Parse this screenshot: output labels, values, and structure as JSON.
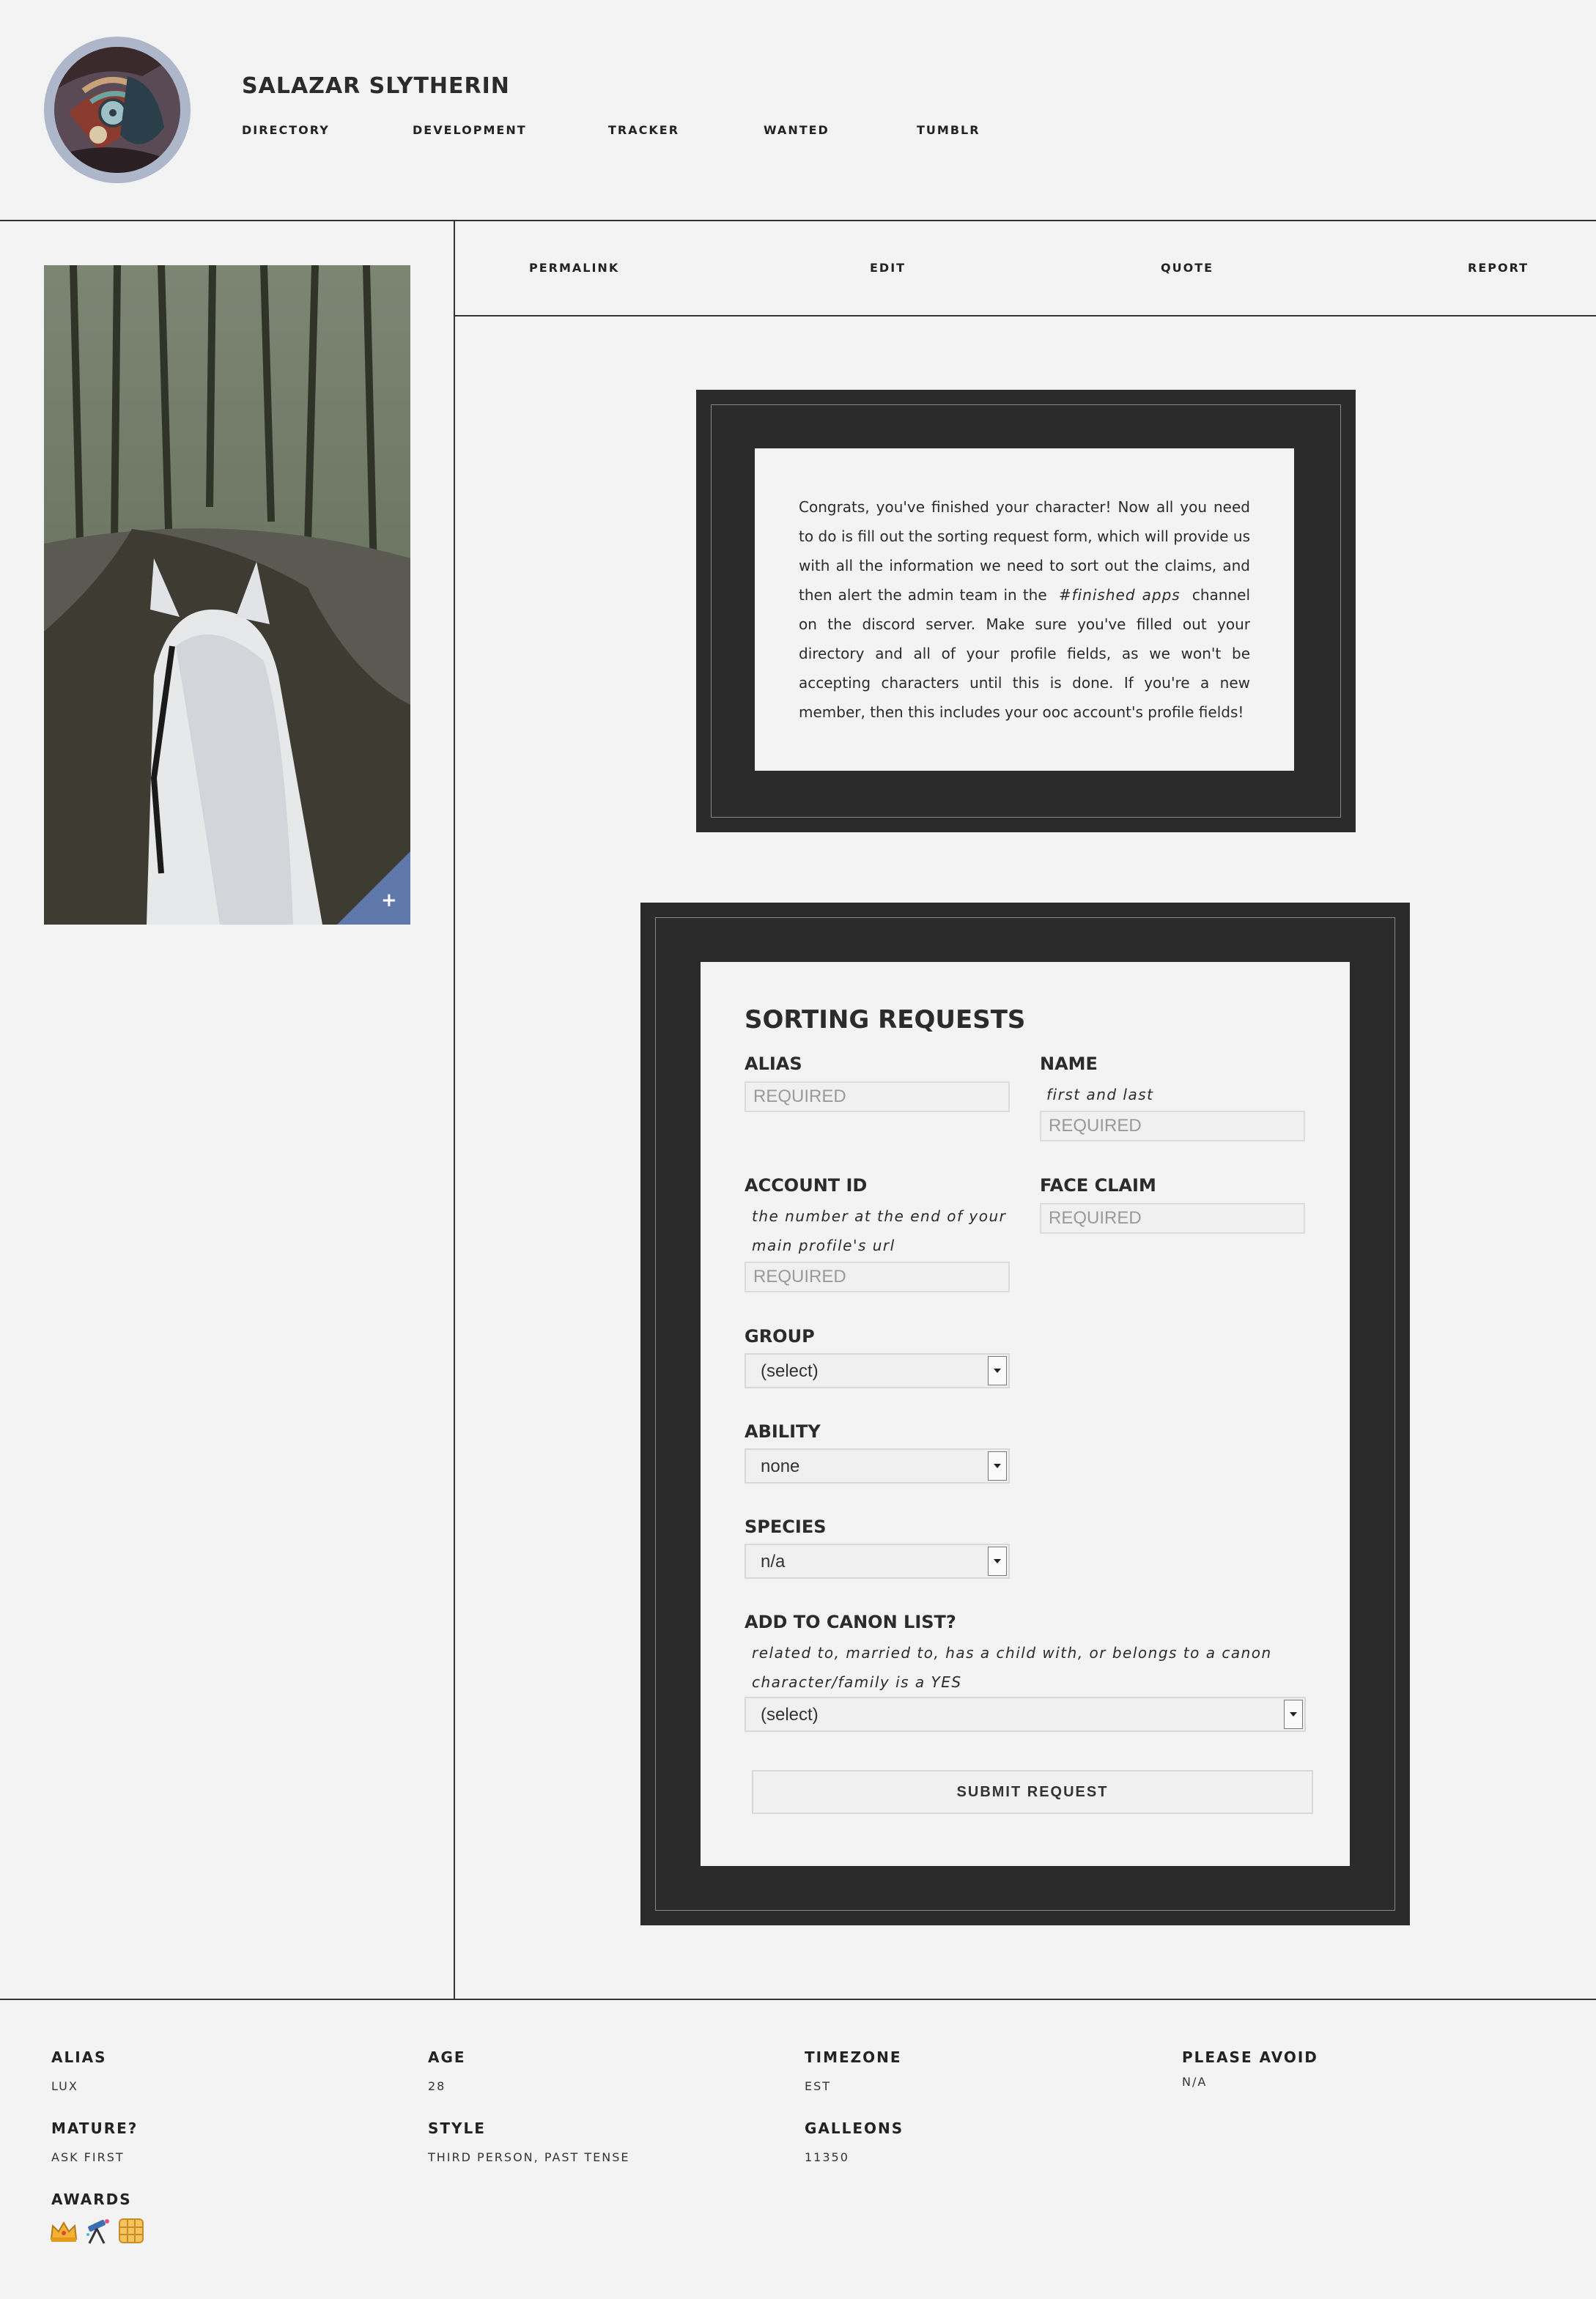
{
  "header": {
    "title": "SALAZAR SLYTHERIN",
    "nav": [
      "DIRECTORY",
      "DEVELOPMENT",
      "TRACKER",
      "WANTED",
      "TUMBLR"
    ]
  },
  "actions": [
    "PERMALINK",
    "EDIT",
    "QUOTE",
    "REPORT"
  ],
  "photo": {
    "expand_glyph": "+",
    "accent": "#5f79ab"
  },
  "notice": {
    "text_before": "Congrats, you've finished your character! Now all you need to do is fill out the sorting request form, which will provide us with all the information we need to sort out the claims, and then alert the admin team in the",
    "channel": "#finished apps",
    "text_after": "channel on the discord server. Make sure you've filled out your directory and all of your profile fields, as we won't be accepting characters until this is done. If you're a new member, then this includes your ooc account's profile fields!"
  },
  "form": {
    "heading": "SORTING REQUESTS",
    "alias": {
      "label": "ALIAS",
      "placeholder": "REQUIRED"
    },
    "name": {
      "label": "NAME",
      "hint": "first and last",
      "placeholder": "REQUIRED"
    },
    "account_id": {
      "label": "ACCOUNT ID",
      "hint1": "the number at the end of your",
      "hint2": "main profile's url",
      "placeholder": "REQUIRED"
    },
    "face_claim": {
      "label": "FACE CLAIM",
      "placeholder": "REQUIRED"
    },
    "group": {
      "label": "GROUP",
      "value": "(select)"
    },
    "ability": {
      "label": "ABILITY",
      "value": "none"
    },
    "species": {
      "label": "SPECIES",
      "value": "n/a"
    },
    "canon": {
      "label": "ADD TO CANON LIST?",
      "hint1": "related to, married to, has a child with, or belongs to a canon",
      "hint2": "character/family is a YES",
      "value": "(select)"
    },
    "submit": "SUBMIT REQUEST"
  },
  "footer": {
    "alias": {
      "label": "ALIAS",
      "value": "LUX"
    },
    "age": {
      "label": "AGE",
      "value": "28"
    },
    "timezone": {
      "label": "TIMEZONE",
      "value": "EST"
    },
    "please_avoid": {
      "label": "PLEASE AVOID",
      "value": "N/A"
    },
    "mature": {
      "label": "MATURE?",
      "value": "ASK FIRST"
    },
    "style": {
      "label": "STYLE",
      "value": "THIRD PERSON, PAST TENSE"
    },
    "galleons": {
      "label": "GALLEONS",
      "value": "11350"
    },
    "awards": {
      "label": "AWARDS",
      "icons": [
        "crown-award-icon",
        "telescope-award-icon",
        "waffle-award-icon"
      ]
    }
  }
}
